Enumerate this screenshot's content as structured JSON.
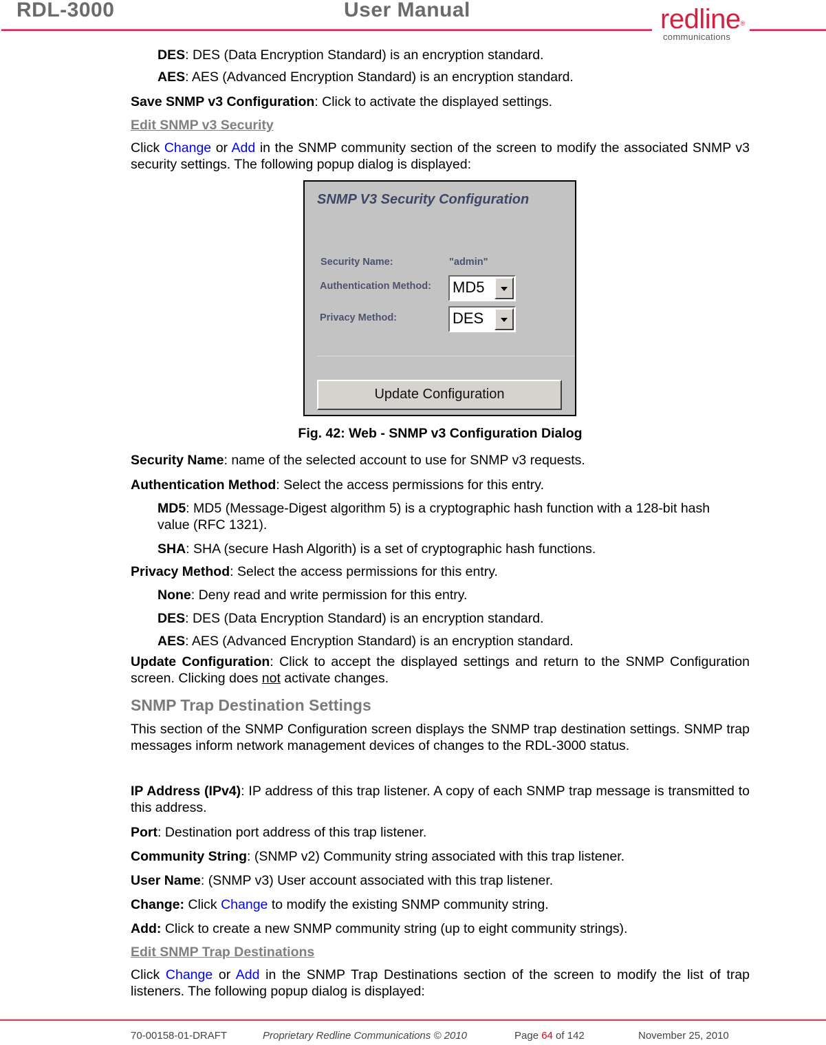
{
  "header": {
    "doc_id": "RDL-3000",
    "doc_type": "User Manual",
    "logo_main": "redline",
    "logo_sub": "communications",
    "logo_trademark": "®",
    "brand_color": "#d3213f"
  },
  "body": {
    "des_term": "DES",
    "des_desc": ": DES (Data Encryption Standard) is an encryption standard.",
    "aes_term": "AES",
    "aes_desc": ": AES (Advanced Encryption Standard) is an encryption standard.",
    "save_term": "Save SNMP v3 Configuration",
    "save_desc": ": Click to activate the displayed settings.",
    "edit_security_heading": "Edit SNMP v3 Security",
    "edit_security_p1_a": "Click ",
    "edit_security_link_change": "Change",
    "edit_security_p1_b": " or ",
    "edit_security_link_add": "Add",
    "edit_security_p1_c": " in the SNMP community section of the screen to modify the associated SNMP v3 security settings. The following popup dialog is displayed:",
    "figure": {
      "title": "SNMP V3 Security Configuration",
      "security_name_label": "Security Name:",
      "security_name_value": "\"admin\"",
      "auth_method_label": "Authentication Method:",
      "auth_method_value": "MD5",
      "privacy_method_label": "Privacy Method:",
      "privacy_method_value": "DES",
      "update_button": "Update Configuration"
    },
    "caption_prefix": "Fig. 42",
    "caption_text": ": Web - SNMP v3 Configuration Dialog",
    "secname_term": "Security Name",
    "secname_desc": ": name of the selected account to use for SNMP v3 requests.",
    "auth_term": "Authentication Method",
    "auth_desc": ": Select the access permissions for this entry.",
    "md5_term": "MD5",
    "md5_desc": ": MD5 (Message-Digest algorithm 5) is a cryptographic hash function with a 128-bit hash value (RFC 1321).",
    "sha_term": "SHA",
    "sha_desc": ": SHA (secure Hash Algorith) is a set of cryptographic hash functions.",
    "privacy_term": "Privacy Method",
    "privacy_desc": ": Select the access permissions for this entry.",
    "none_term": "None",
    "none_desc": ": Deny read and write permission for this entry.",
    "des2_term": "DES",
    "des2_desc": ": DES (Data Encryption Standard) is an encryption standard.",
    "aes2_term": "AES",
    "aes2_desc": ": AES (Advanced Encryption Standard) is an encryption standard.",
    "update_term": "Update Configuration",
    "update_desc_a": ": Click to accept the displayed settings and return to the SNMP Configuration screen. Clicking does ",
    "update_desc_not": "not",
    "update_desc_b": " activate changes.",
    "trap_heading": "SNMP Trap Destination Settings",
    "trap_intro": "This section of the SNMP Configuration screen displays the SNMP trap destination settings. SNMP trap messages inform network management devices of changes to the RDL-3000 status.",
    "ip_term": "IP Address (IPv4)",
    "ip_desc": ": IP address of this trap listener. A copy of each SNMP trap message is transmitted to this address.",
    "port_term": "Port",
    "port_desc": ": Destination port address of this trap listener.",
    "community_term": "Community String",
    "community_desc": ": (SNMP v2) Community string associated with this trap listener.",
    "user_term": "User Name",
    "user_desc": ": (SNMP v3) User account associated with this trap listener.",
    "change_term": "Change:",
    "change_desc_a": " Click ",
    "change_link": "Change",
    "change_desc_b": " to modify the existing SNMP community string.",
    "add_term": "Add:",
    "add_desc": " Click to create a new SNMP community string (up to eight community strings).",
    "edit_trap_heading": "Edit SNMP Trap Destinations",
    "edit_trap_a": "Click ",
    "edit_trap_link_change": "Change",
    "edit_trap_b": " or ",
    "edit_trap_link_add": "Add",
    "edit_trap_c": " in the SNMP Trap Destinations section of the screen to modify the list of trap listeners. The following popup dialog is displayed:"
  },
  "footer": {
    "doc_number": "70-00158-01-DRAFT",
    "copyright": "Proprietary Redline Communications © 2010",
    "page_prefix": "Page ",
    "page_current": "64",
    "page_suffix": " of 142",
    "date": "November 25, 2010"
  }
}
